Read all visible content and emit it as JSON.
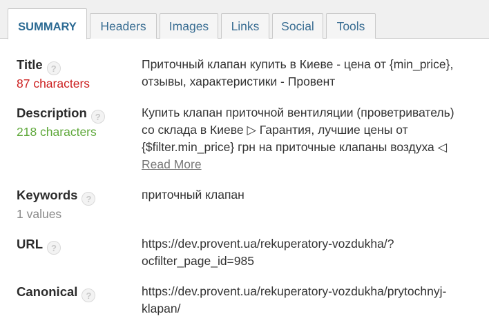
{
  "tabs": [
    {
      "label": "SUMMARY",
      "active": true
    },
    {
      "label": "Headers"
    },
    {
      "label": "Images"
    },
    {
      "label": "Links"
    },
    {
      "label": "Social"
    },
    {
      "label": "Tools"
    }
  ],
  "help_glyph": "?",
  "rows": {
    "title": {
      "label": "Title",
      "sub": "87 characters",
      "lines": [
        "Приточный клапан купить в Киеве - цена от {min_price},",
        "отзывы, характеристики - Провент"
      ]
    },
    "description": {
      "label": "Description",
      "sub": "218 characters",
      "lines": [
        "Купить клапан приточной вентиляции (проветриватель)",
        "со склада в Киеве ▷ Гарантия, лучшие цены от",
        "{$filter.min_price} грн на приточные клапаны воздуха ◁"
      ],
      "read_more": "Read More"
    },
    "keywords": {
      "label": "Keywords",
      "sub": "1 values",
      "lines": [
        "приточный клапан"
      ]
    },
    "url": {
      "label": "URL",
      "lines": [
        "https://dev.provent.ua/rekuperatory-vozdukha/?",
        "ocfilter_page_id=985"
      ]
    },
    "canonical": {
      "label": "Canonical",
      "lines": [
        "https://dev.provent.ua/rekuperatory-vozdukha/prytochnyj-",
        "klapan/"
      ]
    }
  },
  "colors": {
    "tab_text": "#3a6e93",
    "count_over": "#cc1f1f",
    "count_ok": "#5ea83a",
    "count_neutral": "#8a8a8a"
  }
}
